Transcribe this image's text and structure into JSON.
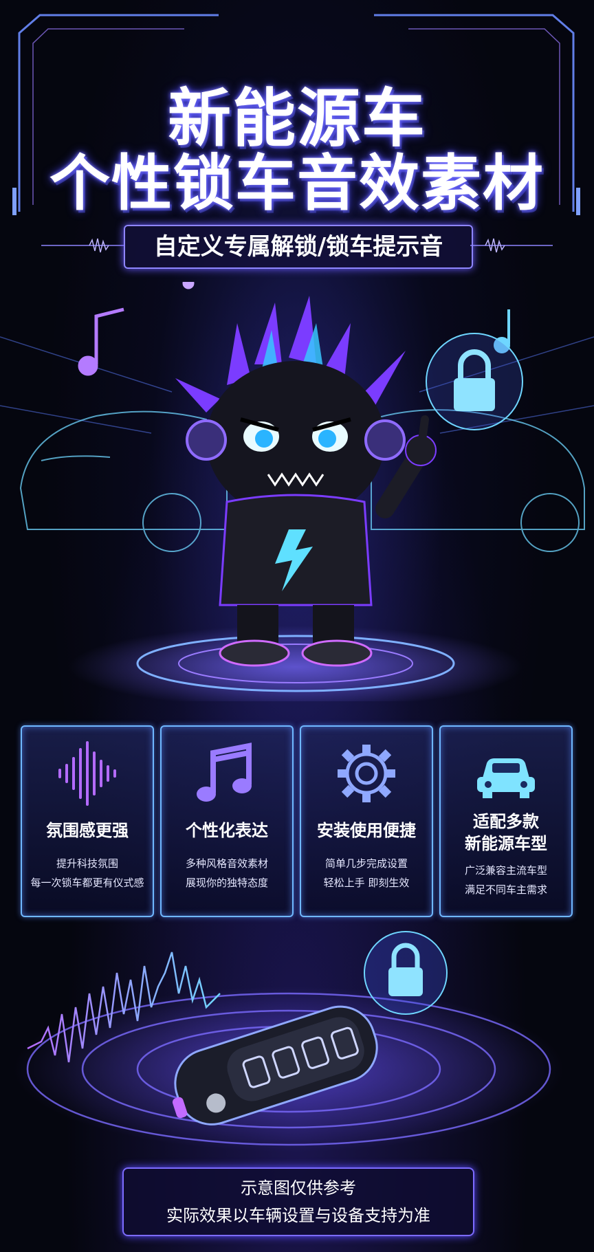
{
  "poster": {
    "title_line1": "新能源车",
    "title_line2": "个性锁车音效素材",
    "subtitle": "自定义专属解锁/锁车提示音"
  },
  "features": [
    {
      "icon": "sound-wave-icon",
      "title": "氛围感更强",
      "desc_line1": "提升科技氛围",
      "desc_line2": "每一次锁车都更有仪式感"
    },
    {
      "icon": "music-note-icon",
      "title": "个性化表达",
      "desc_line1": "多种风格音效素材",
      "desc_line2": "展现你的独特态度"
    },
    {
      "icon": "gear-icon",
      "title": "安装使用便捷",
      "desc_line1": "简单几步完成设置",
      "desc_line2": "轻松上手 即刻生效"
    },
    {
      "icon": "car-icon",
      "title_line1": "适配多款",
      "title_line2": "新能源车型",
      "desc_line1": "广泛兼容主流车型",
      "desc_line2": "满足不同车主需求"
    }
  ],
  "disclaimer": {
    "line1": "示意图仅供参考",
    "line2": "实际效果以车辆设置与设备支持为准"
  },
  "colors": {
    "accent_purple": "#8f86ff",
    "accent_cyan": "#6fd6ff",
    "background": "#05060f"
  }
}
